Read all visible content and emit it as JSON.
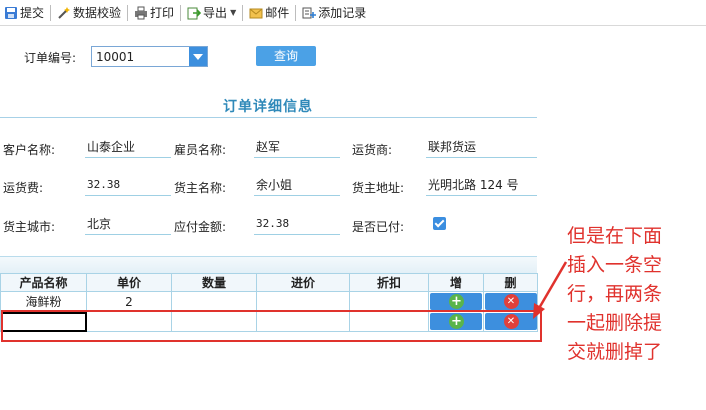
{
  "toolbar": {
    "items": [
      {
        "label": "提交"
      },
      {
        "label": "数据校验"
      },
      {
        "label": "打印"
      },
      {
        "label": "导出"
      },
      {
        "label": "邮件"
      },
      {
        "label": "添加记录"
      }
    ]
  },
  "query": {
    "label": "订单编号:",
    "select_value": "10001",
    "button_label": "查询"
  },
  "form": {
    "title": "订单详细信息",
    "fields": [
      {
        "label": "客户名称:",
        "value": "山泰企业"
      },
      {
        "label": "雇员名称:",
        "value": "赵军"
      },
      {
        "label": "运货商:",
        "value": "联邦货运"
      },
      {
        "label": "运货费:",
        "value": "32.38"
      },
      {
        "label": "货主名称:",
        "value": "余小姐"
      },
      {
        "label": "货主地址:",
        "value": "光明北路 124 号"
      },
      {
        "label": "货主城市:",
        "value": "北京"
      },
      {
        "label": "应付金额:",
        "value": "32.38"
      },
      {
        "label": "是否已付:",
        "checked": true
      }
    ]
  },
  "grid": {
    "columns": [
      "产品名称",
      "单价",
      "数量",
      "进价",
      "折扣",
      "增",
      "删"
    ],
    "rows": [
      {
        "product": "海鲜粉",
        "price": "2",
        "qty": "",
        "cost": "",
        "discount": ""
      },
      {
        "product": "",
        "price": "",
        "qty": "",
        "cost": "",
        "discount": ""
      }
    ]
  },
  "annotation": {
    "lines": [
      "但是在下面",
      "插入一条空",
      "行，再两条",
      "一起删除提",
      "交就删掉了"
    ],
    "color": "#e0322d"
  },
  "colors": {
    "accent": "#3d8fde",
    "title": "#2f89b9",
    "add_green": "#59b44b",
    "delete_red": "#e0403b"
  }
}
